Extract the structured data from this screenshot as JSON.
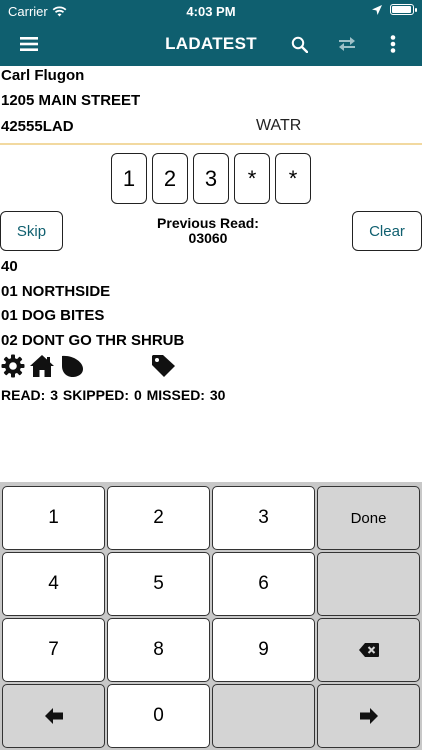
{
  "status_bar": {
    "carrier": "Carrier",
    "time": "4:03 PM",
    "battery_level": 0.9
  },
  "nav": {
    "title": "LADATEST",
    "icons": [
      "menu-icon",
      "search-icon",
      "swap-icon",
      "more-vertical-icon"
    ],
    "accent": "#0f5f6f"
  },
  "customer": {
    "name": "Carl Flugon",
    "address": "1205 MAIN STREET",
    "account": "42555LAD",
    "service": "WATR"
  },
  "reading": {
    "digits": [
      "1",
      "2",
      "3",
      "*",
      "*"
    ],
    "skip_label": "Skip",
    "clear_label": "Clear",
    "previous_label": "Previous Read:",
    "previous_value": "03060"
  },
  "notes": {
    "line1": "40",
    "line2": "01 NORTHSIDE",
    "line3": "01 DOG BITES",
    "line4": "02 DONT GO THR SHRUB"
  },
  "status_icons": [
    "gear-icon",
    "house-icon",
    "drop-icon",
    "tag-icon"
  ],
  "stats": {
    "read_label": "READ:",
    "read": "3",
    "skipped_label": "SKIPPED:",
    "skipped": "0",
    "missed_label": "MISSED:",
    "missed": "30"
  },
  "keypad": {
    "k1": "1",
    "k2": "2",
    "k3": "3",
    "done": "Done",
    "k4": "4",
    "k5": "5",
    "k6": "6",
    "k7": "7",
    "k8": "8",
    "k9": "9",
    "k0": "0"
  }
}
